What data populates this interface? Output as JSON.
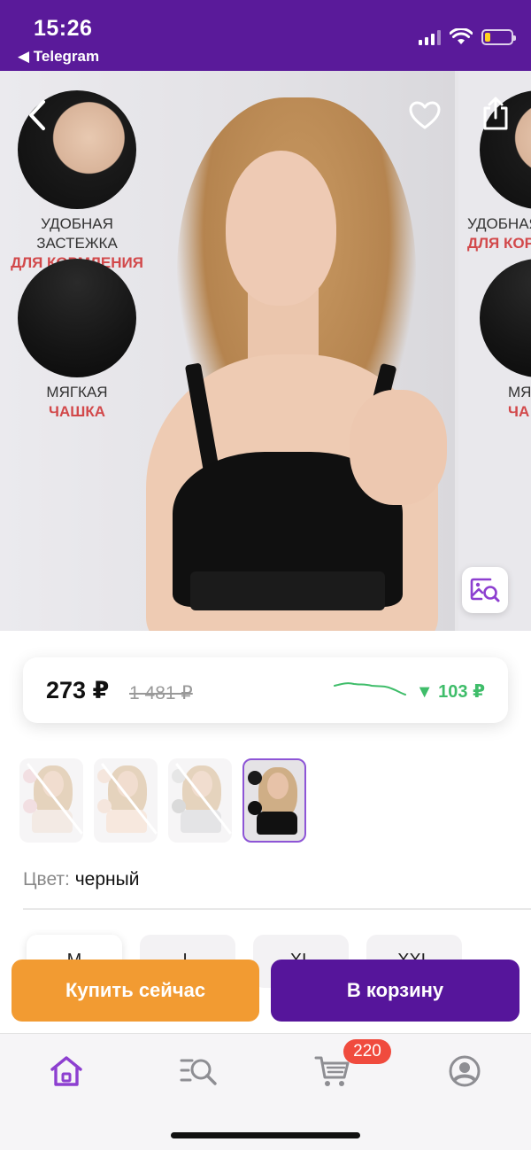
{
  "status_bar": {
    "time": "15:26",
    "back_app": "◀ Telegram",
    "signal_icon": "cellular-signal-icon",
    "wifi_icon": "wifi-icon",
    "battery_icon": "battery-low-icon",
    "battery_level": 0.2
  },
  "gallery": {
    "features": [
      {
        "line1": "УДОБНАЯ ЗАСТЕЖКА",
        "line2": "ДЛЯ КОРМЛЕНИЯ"
      },
      {
        "line1": "МЯГКАЯ",
        "line2": "ЧАШКА"
      }
    ],
    "next_slide": {
      "line1": "УДОБНАЯ З",
      "line2": "ДЛЯ КОР",
      "line3": "МЯ",
      "line4": "ЧА"
    },
    "back_icon": "chevron-left-icon",
    "favorite_icon": "heart-outline-icon",
    "share_icon": "share-icon",
    "image_search_icon": "image-search-icon"
  },
  "price": {
    "current": "273 ₽",
    "old": "1 481 ₽",
    "drop": "▼ 103 ₽",
    "trend_color": "#3fbd6a"
  },
  "thumbnails": [
    {
      "state": "unavailable"
    },
    {
      "state": "unavailable"
    },
    {
      "state": "unavailable"
    },
    {
      "state": "selected"
    }
  ],
  "color": {
    "label": "Цвет:",
    "value": "черный"
  },
  "sizes": [
    "M",
    "L",
    "XL",
    "XXL"
  ],
  "actions": {
    "buy_now": "Купить сейчас",
    "add_to_cart": "В корзину"
  },
  "tabbar": {
    "cart_count": "220",
    "accent": "#8d3fd0"
  },
  "colors": {
    "brand_purple": "#5a1a9a",
    "buy_orange": "#f29b32",
    "cart_purple": "#56159b",
    "badge_red": "#f04b3e"
  }
}
